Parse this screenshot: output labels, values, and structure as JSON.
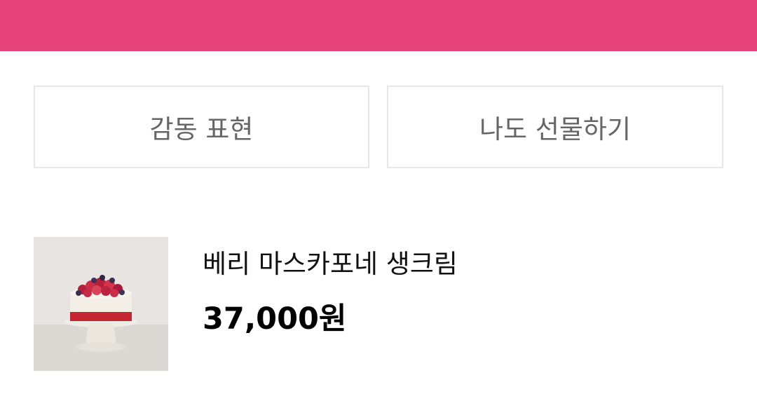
{
  "header": {
    "bar_color": "#e5437a"
  },
  "actions": {
    "express_label": "감동 표현",
    "gift_label": "나도 선물하기"
  },
  "product": {
    "name": "베리 마스카포네 생크림",
    "price": "37,000원",
    "image_icon": "cake-image"
  }
}
